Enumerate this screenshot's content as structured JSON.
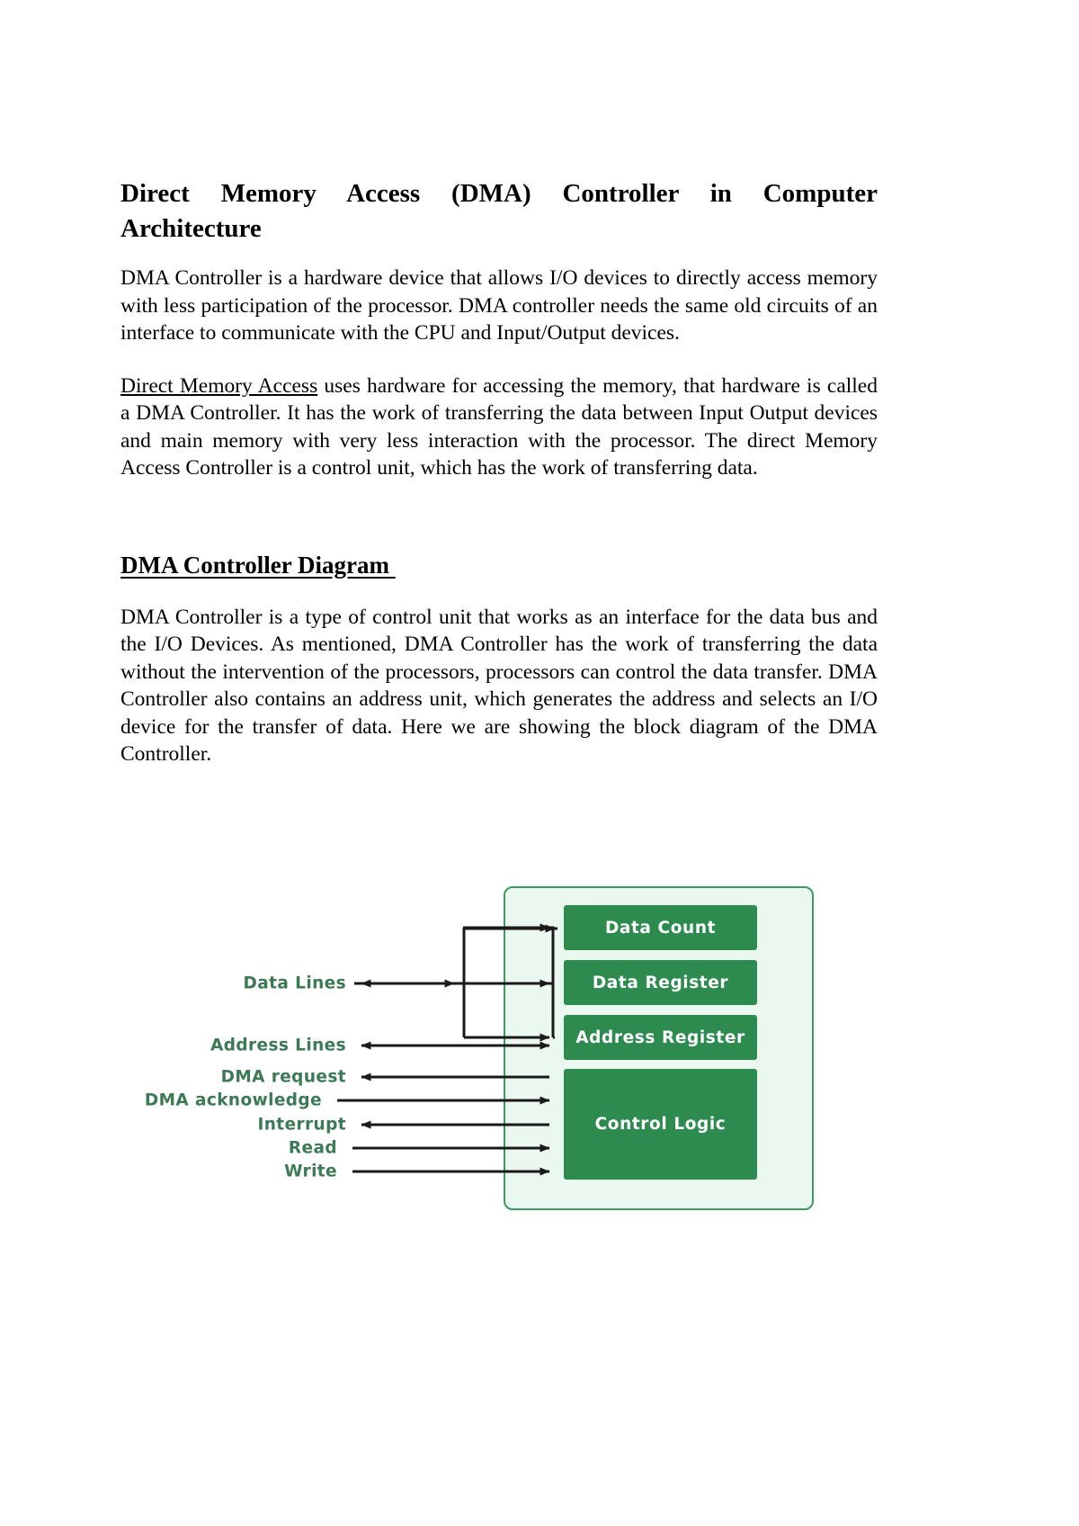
{
  "document": {
    "title": "Direct Memory Access (DMA) Controller in Computer Architecture",
    "title_line1": "Direct Memory Access (DMA) Controller in Computer",
    "title_line2": "Architecture",
    "paragraph1": "DMA Controller is a hardware device that allows I/O devices to directly access memory with less participation of the processor. DMA controller needs the same old circuits of an interface to communicate with the CPU and Input/Output devices.",
    "paragraph2_underlined_lead": "Direct Memory Access",
    "paragraph2_rest": " uses hardware for accessing the memory, that hardware is called a DMA Controller. It has the work of transferring the data between Input Output devices and main memory with very less interaction with the processor. The direct Memory Access Controller is a control unit, which has the work of transferring data.",
    "section_heading": "DMA Controller Diagram ",
    "paragraph3": "DMA Controller is a type of control unit that works as an interface for the data bus and the I/O Devices. As mentioned, DMA Controller has the work of transferring the data without the intervention of the processors, processors can control the data transfer. DMA Controller also contains an address unit, which generates the address and selects an I/O device for the transfer of data. Here we are showing the block diagram of the DMA Controller."
  },
  "diagram": {
    "container_label": "dma-controller-container",
    "blocks": [
      {
        "id": "data-count",
        "label": "Data Count"
      },
      {
        "id": "data-register",
        "label": "Data Register"
      },
      {
        "id": "address-register",
        "label": "Address Register"
      },
      {
        "id": "control-logic",
        "label": "Control Logic"
      }
    ],
    "signals": [
      {
        "id": "data-lines",
        "label": "Data Lines",
        "direction": "bidirectional"
      },
      {
        "id": "address-lines",
        "label": "Address Lines",
        "direction": "bidirectional"
      },
      {
        "id": "dma-request",
        "label": "DMA request",
        "direction": "out"
      },
      {
        "id": "dma-acknowledge",
        "label": "DMA acknowledge",
        "direction": "in"
      },
      {
        "id": "interrupt",
        "label": "Interrupt",
        "direction": "out"
      },
      {
        "id": "read",
        "label": "Read",
        "direction": "in"
      },
      {
        "id": "write",
        "label": "Write",
        "direction": "in"
      }
    ],
    "colors": {
      "block_fill": "#2e8b50",
      "block_text": "#ffffff",
      "container_fill": "#eaf8ef",
      "container_border": "#3d9a63",
      "label_text": "#3b7a54",
      "wire": "#1a1a1a"
    }
  }
}
